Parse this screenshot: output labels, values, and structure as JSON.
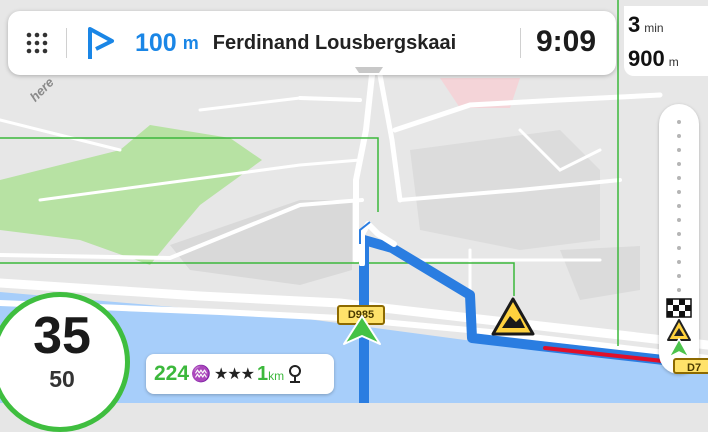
{
  "instruction": {
    "distance_value": "100",
    "distance_unit": "m",
    "street": "Ferdinand Lousbergskaai"
  },
  "arrival_time": "9:09",
  "remaining": {
    "time_value": "3",
    "time_unit": "min",
    "distance_value": "900",
    "distance_unit": "m"
  },
  "speed": {
    "current": "35",
    "limit": "50"
  },
  "info_pill": {
    "count": "224",
    "stars": "★★★",
    "distance_value": "1",
    "distance_unit": "km"
  },
  "road_shields": {
    "d985": "D985",
    "d7": "D7"
  },
  "map_watermark": "here",
  "icons": {
    "menu": "menu-grid-icon",
    "turn": "turn-right-flag-icon",
    "eco": "eco-icon",
    "parking": "parking-icon",
    "destination": "checkered-flag-icon",
    "warning": "road-hazard-warning-icon",
    "position": "gps-position-arrow-icon"
  },
  "colors": {
    "route": "#2a7de1",
    "accent_blue": "#1a86e6",
    "speed_ring": "#3fbe3f",
    "water": "#a5cdfb",
    "park": "#b6e3a2",
    "traffic_red": "#e0102a"
  }
}
